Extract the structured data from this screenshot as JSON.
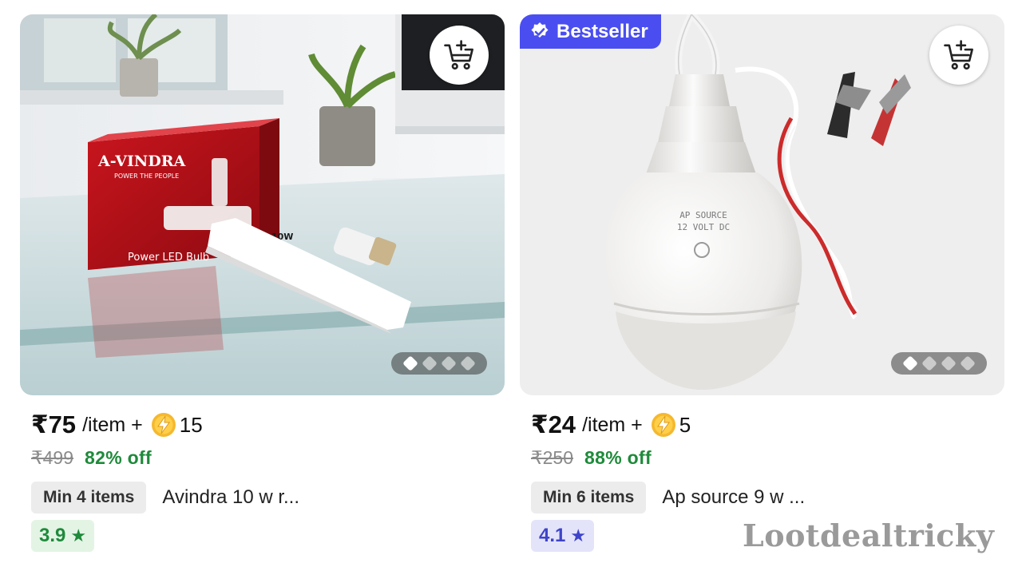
{
  "products": [
    {
      "price": "₹75",
      "per_item": "/item +",
      "coins": "15",
      "mrp": "₹499",
      "discount": "82% off",
      "min_items": "Min 4 items",
      "name": "Avindra 10 w r...",
      "rating": "3.9",
      "rating_color": "#1f8a3b",
      "image_text": {
        "brand": "A-VINDRA",
        "tagline": "POWER THE PEOPLE",
        "product": "Power LED Bulb",
        "wattage": "10W"
      },
      "carousel": {
        "count": 4,
        "active": 1
      }
    },
    {
      "badge": "Bestseller",
      "price": "₹24",
      "per_item": "/item +",
      "coins": "5",
      "mrp": "₹250",
      "discount": "88% off",
      "min_items": "Min 6 items",
      "name": "Ap source 9 w ...",
      "rating": "4.1",
      "rating_color": "#3f44c9",
      "carousel": {
        "count": 4,
        "active": 1
      }
    }
  ],
  "watermark": "Lootdealtricky",
  "icons": {
    "cart": "add-to-cart-icon",
    "coin": "lightning-coin-icon",
    "star": "star-icon",
    "badge": "verified-badge-icon"
  },
  "colors": {
    "discount_green": "#1f8a3b",
    "bestseller_blue": "#4a4ef0",
    "coin_gold": "#f5b82e"
  }
}
